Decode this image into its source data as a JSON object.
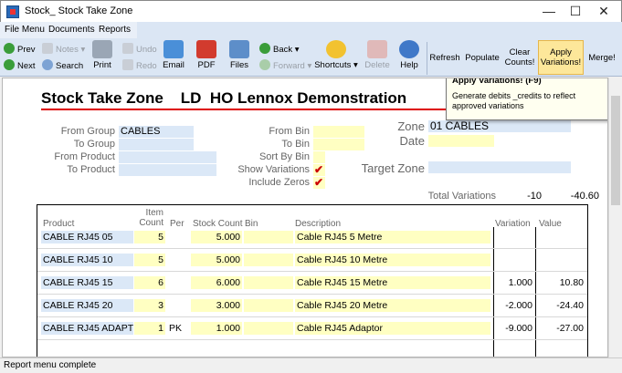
{
  "window": {
    "title": "Stock_ Stock Take Zone",
    "minimize": "—",
    "maximize": "☐",
    "close": "✕"
  },
  "menu": {
    "file": "File Menu",
    "documents": "Documents",
    "reports": "Reports"
  },
  "toolbar": {
    "prev": "Prev",
    "next": "Next",
    "notes": "Notes",
    "search": "Search",
    "undo": "Undo",
    "redo": "Redo",
    "print": "Print",
    "email": "Email",
    "pdf": "PDF",
    "files": "Files",
    "back": "Back",
    "forward": "Forward",
    "shortcuts": "Shortcuts",
    "delete": "Delete",
    "help": "Help",
    "refresh": "Refresh",
    "populate": "Populate",
    "clear_l1": "Clear",
    "clear_l2": "Counts!",
    "apply_l1": "Apply",
    "apply_l2": "Variations!",
    "merge": "Merge!"
  },
  "tooltip": {
    "title": "Apply Variations! (F9)",
    "body": "Generate debits _credits to reflect approved variations"
  },
  "form": {
    "heading": "Stock Take Zone    LD  HO Lennox Demonstration",
    "from_group_label": "From Group",
    "from_group_value": "CABLES",
    "to_group_label": "To Group",
    "to_group_value": "",
    "from_product_label": "From Product",
    "from_product_value": "",
    "to_product_label": "To Product",
    "to_product_value": "",
    "from_bin_label": "From Bin",
    "from_bin_value": "",
    "to_bin_label": "To Bin",
    "to_bin_value": "",
    "sort_by_bin_label": "Sort By Bin",
    "show_variations_label": "Show Variations",
    "show_variations_check": "✔",
    "include_zeros_label": "Include Zeros",
    "include_zeros_check": "✔",
    "zone_label": "Zone",
    "zone_value": "01 CABLES",
    "date_label": "Date",
    "date_value": "",
    "target_zone_label": "Target Zone",
    "target_zone_value": "",
    "total_variations_label": "Total Variations",
    "total_variations_qty": "-10",
    "total_variations_value": "-40.60"
  },
  "table": {
    "headers": {
      "product": "Product",
      "item_count_l1": "Item",
      "item_count_l2": "Count",
      "per": "Per",
      "stock_count": "Stock Count",
      "bin": "Bin",
      "description": "Description",
      "variation": "Variation",
      "value": "Value"
    },
    "rows": [
      {
        "product": "CABLE RJ45 05",
        "item_count": "5",
        "per": "",
        "stock_count": "5.000",
        "bin": "",
        "description": "Cable RJ45 5 Metre",
        "variation": "",
        "value": ""
      },
      {
        "product": "CABLE RJ45 10",
        "item_count": "5",
        "per": "",
        "stock_count": "5.000",
        "bin": "",
        "description": "Cable RJ45 10 Metre",
        "variation": "",
        "value": ""
      },
      {
        "product": "CABLE RJ45 15",
        "item_count": "6",
        "per": "",
        "stock_count": "6.000",
        "bin": "",
        "description": "Cable RJ45 15 Metre",
        "variation": "1.000",
        "value": "10.80"
      },
      {
        "product": "CABLE RJ45 20",
        "item_count": "3",
        "per": "",
        "stock_count": "3.000",
        "bin": "",
        "description": "Cable RJ45 20 Metre",
        "variation": "-2.000",
        "value": "-24.40"
      },
      {
        "product": "CABLE RJ45 ADAPT",
        "item_count": "1",
        "per": "PK",
        "stock_count": "1.000",
        "bin": "",
        "description": "Cable RJ45 Adaptor",
        "variation": "-9.000",
        "value": "-27.00"
      }
    ]
  },
  "status": {
    "text": "Report menu complete"
  },
  "colors": {
    "ribbon": "#dbe6f4",
    "field_blue": "#dbe8f7",
    "field_yellow": "#ffffc2",
    "heading_rule": "#d00000",
    "active_button": "#fde79a"
  }
}
